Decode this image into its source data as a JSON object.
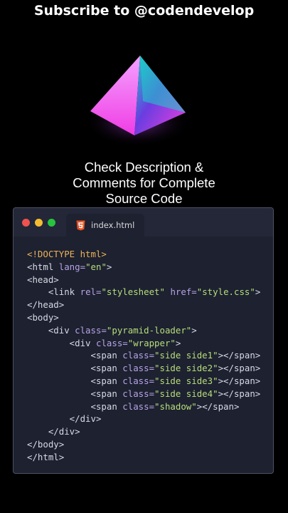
{
  "header": {
    "title": "Subscribe to @codendevelop"
  },
  "caption": {
    "lines": [
      "Check Description &",
      "Comments for Complete",
      "Source Code"
    ]
  },
  "editor": {
    "window_controls": [
      "close",
      "minimize",
      "maximize"
    ],
    "tab": {
      "label": "index.html",
      "icon": "html5-icon"
    },
    "code_lines": [
      [
        {
          "t": "doctype",
          "v": "<!DOCTYPE html>"
        }
      ],
      [
        {
          "t": "t",
          "v": "<html "
        },
        {
          "t": "attr",
          "v": "lang="
        },
        {
          "t": "str",
          "v": "\"en\""
        },
        {
          "t": "t",
          "v": ">"
        }
      ],
      [
        {
          "t": "t",
          "v": "<head>"
        }
      ],
      [
        {
          "t": "t",
          "v": "    <link "
        },
        {
          "t": "attr",
          "v": "rel="
        },
        {
          "t": "str",
          "v": "\"stylesheet\""
        },
        {
          "t": "t",
          "v": " "
        },
        {
          "t": "attr",
          "v": "href="
        },
        {
          "t": "str",
          "v": "\"style.css\""
        },
        {
          "t": "t",
          "v": ">"
        }
      ],
      [
        {
          "t": "t",
          "v": "</head>"
        }
      ],
      [
        {
          "t": "t",
          "v": "<body>"
        }
      ],
      [
        {
          "t": "t",
          "v": "    <div "
        },
        {
          "t": "attr",
          "v": "class="
        },
        {
          "t": "str",
          "v": "\"pyramid-loader\""
        },
        {
          "t": "t",
          "v": ">"
        }
      ],
      [
        {
          "t": "t",
          "v": "        <div "
        },
        {
          "t": "attr",
          "v": "class="
        },
        {
          "t": "str",
          "v": "\"wrapper\""
        },
        {
          "t": "t",
          "v": ">"
        }
      ],
      [
        {
          "t": "t",
          "v": "            <span "
        },
        {
          "t": "attr",
          "v": "class="
        },
        {
          "t": "str",
          "v": "\"side side1\""
        },
        {
          "t": "t",
          "v": "></span>"
        }
      ],
      [
        {
          "t": "t",
          "v": "            <span "
        },
        {
          "t": "attr",
          "v": "class="
        },
        {
          "t": "str",
          "v": "\"side side2\""
        },
        {
          "t": "t",
          "v": "></span>"
        }
      ],
      [
        {
          "t": "t",
          "v": "            <span "
        },
        {
          "t": "attr",
          "v": "class="
        },
        {
          "t": "str",
          "v": "\"side side3\""
        },
        {
          "t": "t",
          "v": "></span>"
        }
      ],
      [
        {
          "t": "t",
          "v": "            <span "
        },
        {
          "t": "attr",
          "v": "class="
        },
        {
          "t": "str",
          "v": "\"side side4\""
        },
        {
          "t": "t",
          "v": "></span>"
        }
      ],
      [
        {
          "t": "t",
          "v": "            <span "
        },
        {
          "t": "attr",
          "v": "class="
        },
        {
          "t": "str",
          "v": "\"shadow\""
        },
        {
          "t": "t",
          "v": "></span>"
        }
      ],
      [
        {
          "t": "t",
          "v": "        </div>"
        }
      ],
      [
        {
          "t": "t",
          "v": "    </div>"
        }
      ],
      [
        {
          "t": "t",
          "v": "</body>"
        }
      ],
      [
        {
          "t": "t",
          "v": "</html>"
        }
      ]
    ]
  },
  "colors": {
    "background": "#000000",
    "editor_bg": "#1d2130",
    "tag": "#d6dae6",
    "doctype": "#ebb25a",
    "attribute": "#b7a3e6",
    "string": "#b7dd7a",
    "html5_icon": "#e44d26"
  }
}
